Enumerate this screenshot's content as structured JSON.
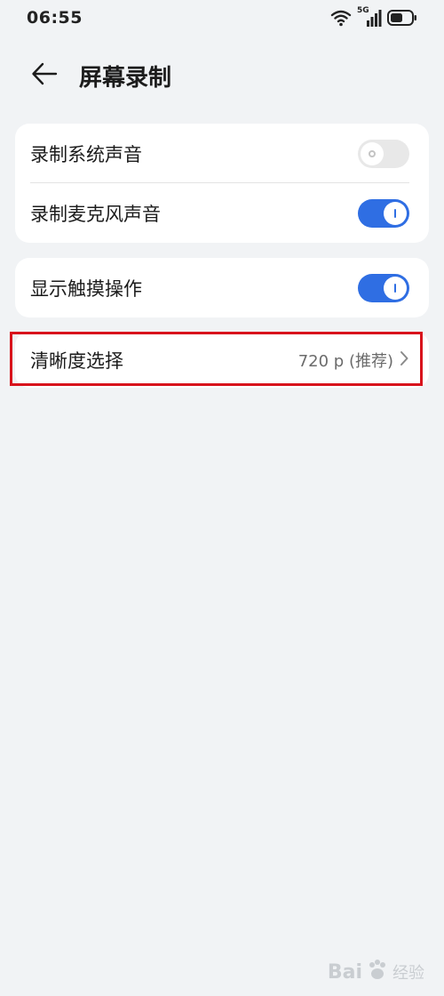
{
  "status_bar": {
    "time": "06:55",
    "network": "5G",
    "icons": [
      "wifi-icon",
      "signal-icon",
      "battery-icon"
    ]
  },
  "header": {
    "title": "屏幕录制",
    "back_icon": "arrow-left-icon"
  },
  "card_audio": {
    "items": [
      {
        "label": "录制系统声音",
        "enabled": false
      },
      {
        "label": "录制麦克风声音",
        "enabled": true
      }
    ]
  },
  "card_touch": {
    "items": [
      {
        "label": "显示触摸操作",
        "enabled": true
      }
    ]
  },
  "card_quality": {
    "label": "清晰度选择",
    "value": "720 p (推荐)",
    "icon": "chevron-right-icon"
  },
  "colors": {
    "accent": "#2f6ee3",
    "background": "#f1f3f5",
    "highlight": "#d8131c"
  },
  "watermark": {
    "brand": "Bai",
    "suffix": "经验"
  }
}
